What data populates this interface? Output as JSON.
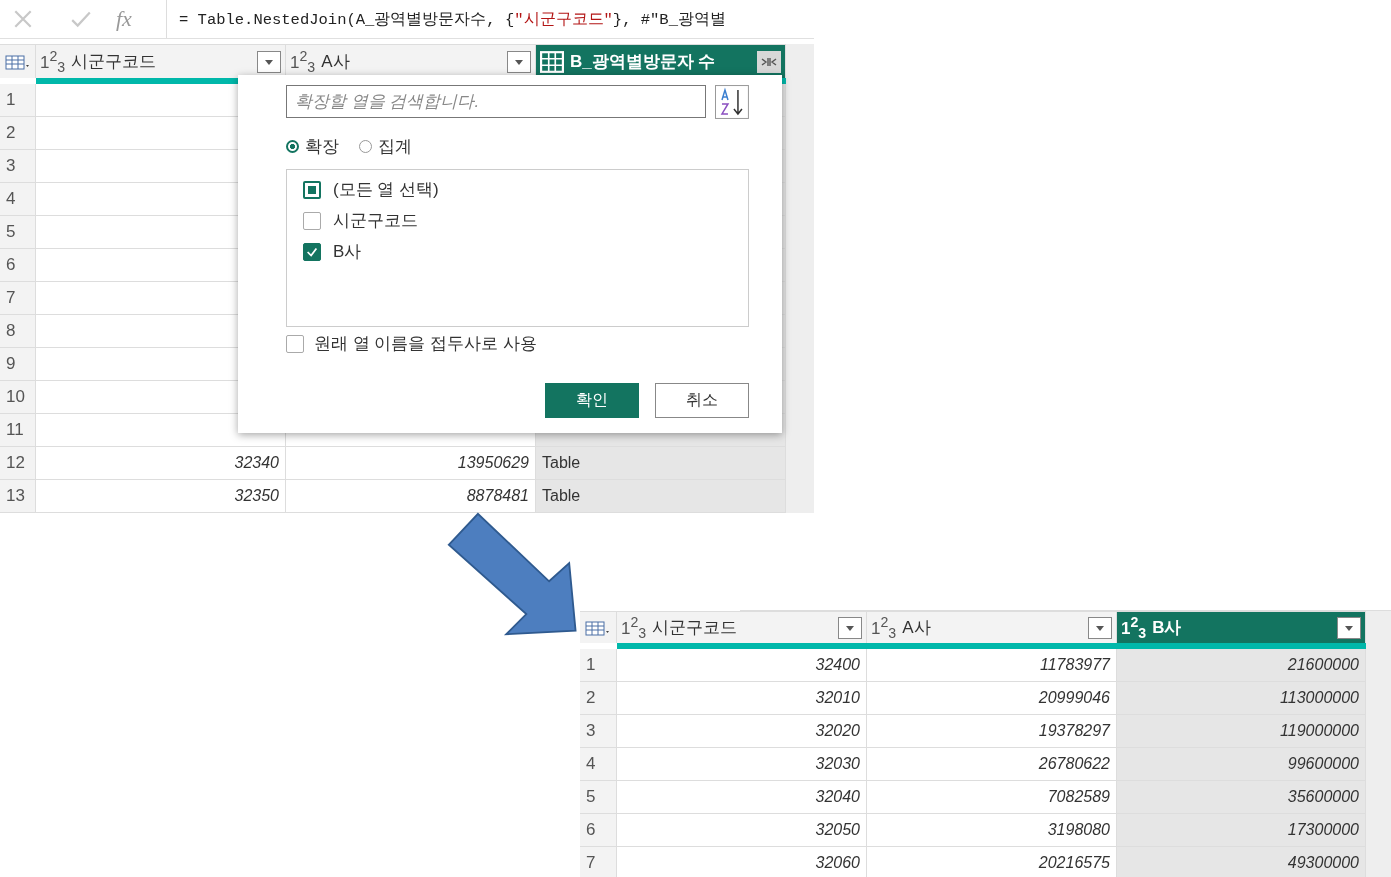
{
  "before": {
    "formula_bar": {
      "fx": "fx",
      "prefix": "= Table.NestedJoin(A_광역별방문자수, {",
      "string": "\"시군구코드\"",
      "suffix": "}, #\"B_광역별"
    },
    "columns": [
      {
        "type": "1$^{2}$$_{3}$",
        "name": "시군구코드",
        "kind": "number",
        "selected": false
      },
      {
        "type": "1$^{2}$$_{3}$",
        "name": "A사",
        "kind": "number",
        "selected": false
      },
      {
        "name": "B_광역별방문자 수",
        "kind": "table",
        "selected": true
      }
    ],
    "rows": [
      {
        "number": "1"
      },
      {
        "number": "2"
      },
      {
        "number": "3"
      },
      {
        "number": "4"
      },
      {
        "number": "5"
      },
      {
        "number": "6"
      },
      {
        "number": "7"
      },
      {
        "number": "8"
      },
      {
        "number": "9"
      },
      {
        "number": "10"
      },
      {
        "number": "11"
      },
      {
        "number": "12",
        "cells": [
          "32340",
          "13950629",
          "Table"
        ]
      },
      {
        "number": "13",
        "cells": [
          "32350",
          "8878481",
          "Table"
        ]
      }
    ],
    "expand_dialog": {
      "search": {
        "placeholder": "확장할 열을 검색합니다."
      },
      "modes": [
        {
          "label": "확장",
          "selected": true
        },
        {
          "label": "집계",
          "selected": false
        }
      ],
      "columns": [
        {
          "label": "(모든 열 선택)",
          "checked": false,
          "indeterminate": true
        },
        {
          "label": "시군구코드",
          "checked": false,
          "indeterminate": false
        },
        {
          "label": "B사",
          "checked": true,
          "indeterminate": false
        }
      ],
      "use_prefix": {
        "label": "원래 열 이름을 접두사로 사용",
        "checked": false
      },
      "buttons": [
        {
          "label": "확인",
          "kind": "primary"
        },
        {
          "label": "취소",
          "kind": "secondary"
        }
      ]
    }
  },
  "after": {
    "columns": [
      {
        "type": "1$^{2}$$_{3}$",
        "name": "시군구코드",
        "selected": false
      },
      {
        "type": "1$^{2}$$_{3}$",
        "name": "A사",
        "selected": false
      },
      {
        "type": "1$^{2}$$_{3}$",
        "name": "B사",
        "selected": true
      }
    ],
    "rows": [
      {
        "number": "1",
        "cells": [
          "32400",
          "11783977",
          "21600000"
        ]
      },
      {
        "number": "2",
        "cells": [
          "32010",
          "20999046",
          "113000000"
        ]
      },
      {
        "number": "3",
        "cells": [
          "32020",
          "19378297",
          "119000000"
        ]
      },
      {
        "number": "4",
        "cells": [
          "32030",
          "26780622",
          "99600000"
        ]
      },
      {
        "number": "5",
        "cells": [
          "32040",
          "7082589",
          "35600000"
        ]
      },
      {
        "number": "6",
        "cells": [
          "32050",
          "3198080",
          "17300000"
        ]
      },
      {
        "number": "7",
        "cells": [
          "32060",
          "20216575",
          "49300000"
        ]
      }
    ]
  }
}
